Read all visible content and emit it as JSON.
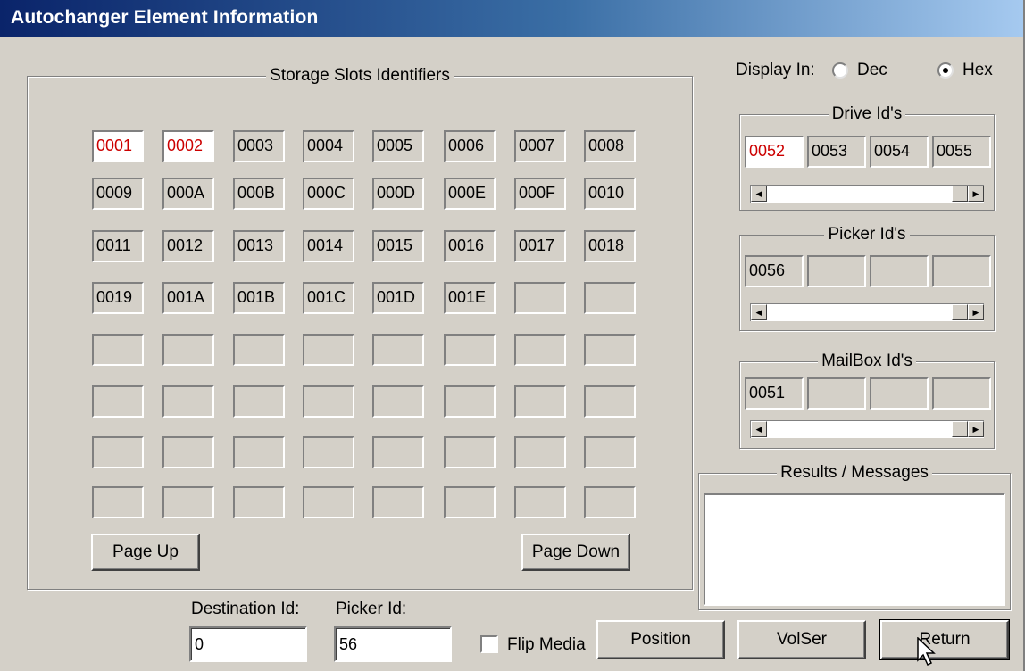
{
  "window": {
    "title": "Autochanger Element Information"
  },
  "storage": {
    "legend": "Storage Slots Identifiers",
    "slots": [
      "0001",
      "0002",
      "0003",
      "0004",
      "0005",
      "0006",
      "0007",
      "0008",
      "0009",
      "000A",
      "000B",
      "000C",
      "000D",
      "000E",
      "000F",
      "0010",
      "0011",
      "0012",
      "0013",
      "0014",
      "0015",
      "0016",
      "0017",
      "0018",
      "0019",
      "001A",
      "001B",
      "001C",
      "001D",
      "001E",
      "",
      "",
      "",
      "",
      "",
      "",
      "",
      "",
      "",
      "",
      "",
      "",
      "",
      "",
      "",
      "",
      "",
      "",
      "",
      "",
      "",
      "",
      "",
      "",
      "",
      "",
      "",
      "",
      "",
      "",
      "",
      "",
      "",
      ""
    ],
    "highlighted": [
      0,
      1
    ],
    "page_up": "Page Up",
    "page_down": "Page Down"
  },
  "display": {
    "label": "Display In:",
    "dec": "Dec",
    "hex": "Hex",
    "selected": "Hex"
  },
  "drive": {
    "legend": "Drive Id's",
    "ids": [
      "0052",
      "0053",
      "0054",
      "0055"
    ],
    "highlighted": [
      0
    ]
  },
  "picker_group": {
    "legend": "Picker Id's",
    "ids": [
      "0056",
      "",
      "",
      ""
    ]
  },
  "mailbox": {
    "legend": "MailBox Id's",
    "ids": [
      "0051",
      "",
      "",
      ""
    ]
  },
  "results": {
    "legend": "Results / Messages",
    "text": ""
  },
  "form": {
    "destination_label": "Destination Id:",
    "destination_value": "0",
    "picker_label": "Picker Id:",
    "picker_value": "56",
    "flip_label": "Flip Media",
    "flip_checked": false
  },
  "buttons": {
    "position": "Position",
    "volser": "VolSer",
    "return": "Return"
  },
  "colors": {
    "title_start": "#0a246a",
    "highlight_text": "#cc0000",
    "face": "#d4d0c8"
  }
}
